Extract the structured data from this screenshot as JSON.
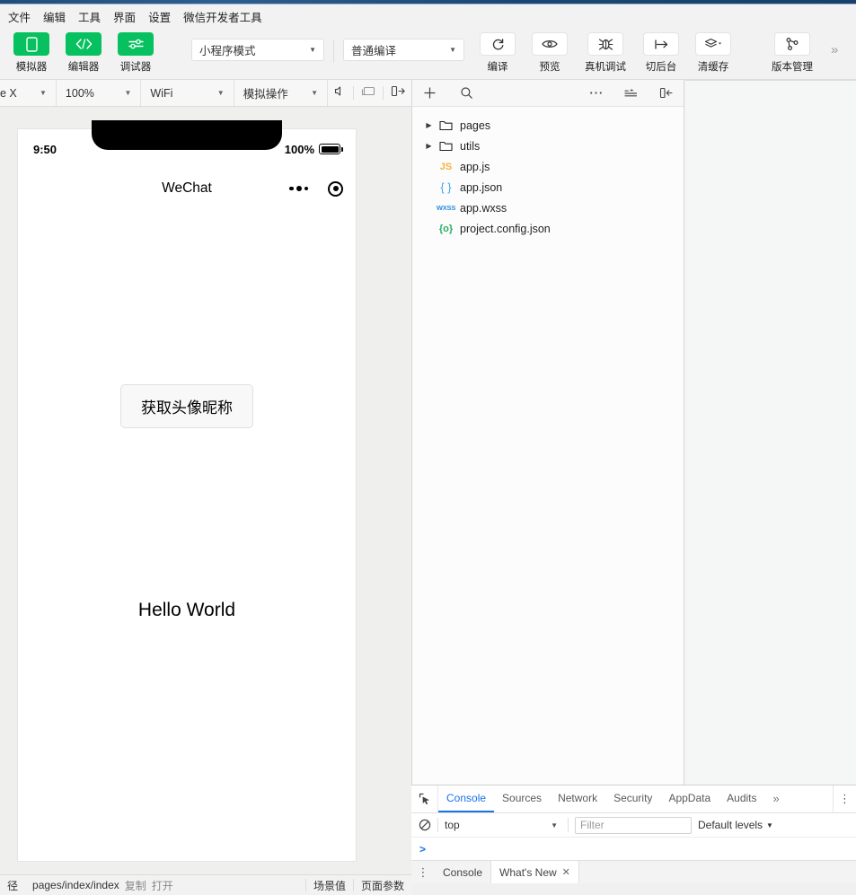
{
  "menubar": {
    "items": [
      {
        "label": "文件"
      },
      {
        "label": "编辑"
      },
      {
        "label": "工具"
      },
      {
        "label": "界面"
      },
      {
        "label": "设置"
      },
      {
        "label": "微信开发者工具"
      }
    ]
  },
  "toolbar": {
    "mode_select": {
      "value": "小程序模式"
    },
    "compile_select": {
      "value": "普通编译"
    },
    "left_buttons": [
      {
        "label": "模拟器",
        "icon": "phone-icon"
      },
      {
        "label": "编辑器",
        "icon": "code-icon"
      },
      {
        "label": "调试器",
        "icon": "sliders-icon"
      }
    ],
    "right_buttons": [
      {
        "label": "编译",
        "icon": "refresh-icon"
      },
      {
        "label": "预览",
        "icon": "eye-icon"
      },
      {
        "label": "真机调试",
        "icon": "bug-icon"
      },
      {
        "label": "切后台",
        "icon": "background-icon"
      },
      {
        "label": "清缓存",
        "icon": "layers-icon"
      },
      {
        "label": "版本管理",
        "icon": "git-branch-icon"
      }
    ],
    "overflow": "»"
  },
  "simulator_bar": {
    "device": "e X",
    "zoom": "100%",
    "network": "WiFi",
    "actions": "模拟操作",
    "icons": [
      "speaker-icon",
      "screen-icon",
      "collapse-panel-icon"
    ]
  },
  "phone": {
    "status": {
      "time": "9:50",
      "battery_percent": "100%"
    },
    "navbar": {
      "title": "WeChat"
    },
    "page": {
      "avatar_button": "获取头像昵称",
      "hello_text": "Hello World"
    }
  },
  "file_tree": {
    "toolbar_icons": [
      "add-icon",
      "search-icon",
      "more-icon",
      "collapse-all-icon",
      "hide-panel-icon"
    ],
    "items": [
      {
        "name": "pages",
        "type": "folder",
        "expandable": true
      },
      {
        "name": "utils",
        "type": "folder",
        "expandable": true
      },
      {
        "name": "app.js",
        "type": "js",
        "badge": "JS"
      },
      {
        "name": "app.json",
        "type": "json",
        "badge": "{ }"
      },
      {
        "name": "app.wxss",
        "type": "wxss",
        "badge": "WXSS"
      },
      {
        "name": "project.config.json",
        "type": "config",
        "badge": "{o}"
      }
    ]
  },
  "devtools": {
    "tabs": [
      {
        "label": "Console",
        "active": true
      },
      {
        "label": "Sources",
        "active": false
      },
      {
        "label": "Network",
        "active": false
      },
      {
        "label": "Security",
        "active": false
      },
      {
        "label": "AppData",
        "active": false
      },
      {
        "label": "Audits",
        "active": false
      }
    ],
    "tabs_overflow": "»",
    "console": {
      "context": "top",
      "filter_placeholder": "Filter",
      "levels": "Default levels",
      "prompt": ">"
    },
    "drawer_tabs": [
      {
        "label": "Console",
        "active": false,
        "closable": false
      },
      {
        "label": "What's New",
        "active": true,
        "closable": true
      }
    ]
  },
  "statusbar": {
    "path_label": "径",
    "path_value": "pages/index/index",
    "copy_label": "复制",
    "open_label": "打开",
    "scene_label": "场景值",
    "params_label": "页面参数"
  },
  "colors": {
    "brand_green": "#07C160",
    "devtools_accent": "#1A73E8",
    "titlebar_blue": "#1F4E79"
  }
}
